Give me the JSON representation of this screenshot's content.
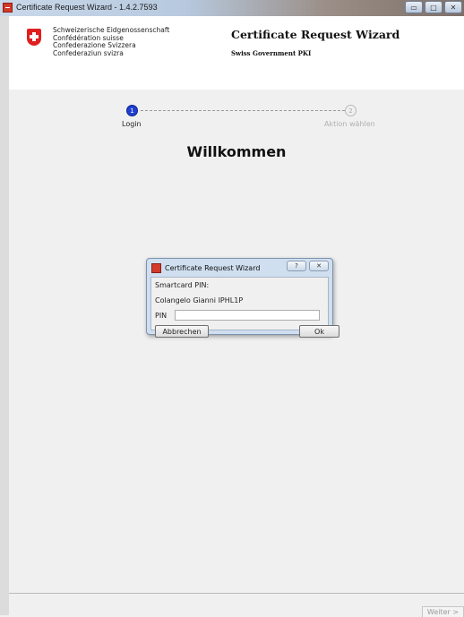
{
  "window": {
    "title": "Certificate Request Wizard - 1.4.2.7593",
    "minimize_glyph": "▭",
    "maximize_glyph": "□",
    "close_glyph": "✕"
  },
  "header": {
    "confederation_lines": [
      "Schweizerische Eidgenossenschaft",
      "Confédération suisse",
      "Confederazione Svizzera",
      "Confederaziun svizra"
    ],
    "title": "Certificate Request Wizard",
    "subtitle": "Swiss Government PKI",
    "logo_icon": "swiss-cross-icon"
  },
  "steps": [
    {
      "number": "1",
      "label": "Login",
      "active": true
    },
    {
      "number": "2",
      "label": "Aktion wählen",
      "active": false
    }
  ],
  "main": {
    "heading": "Willkommen"
  },
  "dialog": {
    "title": "Certificate Request Wizard",
    "help_glyph": "?",
    "close_glyph": "✕",
    "pin_heading": "Smartcard PIN:",
    "user": "Colangelo Gianni IPHL1P",
    "pin_label": "PIN",
    "pin_value": "",
    "cancel_label": "Abbrechen",
    "ok_label": "Ok"
  },
  "footer": {
    "next_label": "Weiter >"
  },
  "colors": {
    "accent_step": "#1e3fcf",
    "swiss_red": "#e01f1f"
  }
}
